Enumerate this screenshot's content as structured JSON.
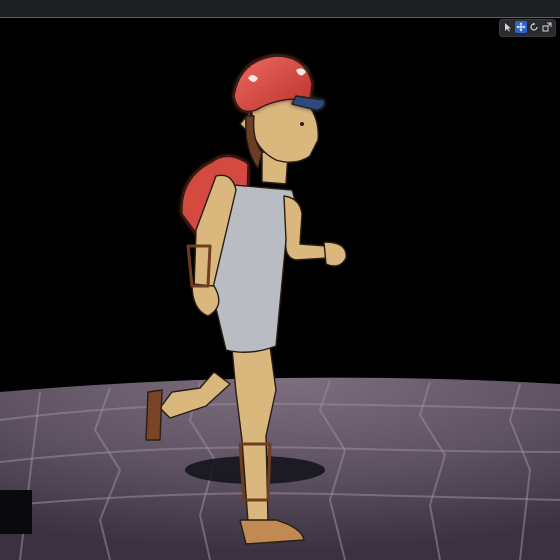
{
  "toolbar": {
    "tools": [
      {
        "icon": "select-cursor-icon",
        "active": false
      },
      {
        "icon": "move-arrows-icon",
        "active": true
      },
      {
        "icon": "rotate-icon",
        "active": false
      },
      {
        "icon": "scale-icon",
        "active": false
      }
    ]
  },
  "colors": {
    "topbar": "#1e1f22",
    "accent": "#2f63c9",
    "background": "#000000",
    "floor": "#6b5f6e",
    "cap": "#d8473f",
    "skin": "#d9b77d",
    "tunic": "#b9bcc3",
    "strap": "#6e3e22"
  }
}
